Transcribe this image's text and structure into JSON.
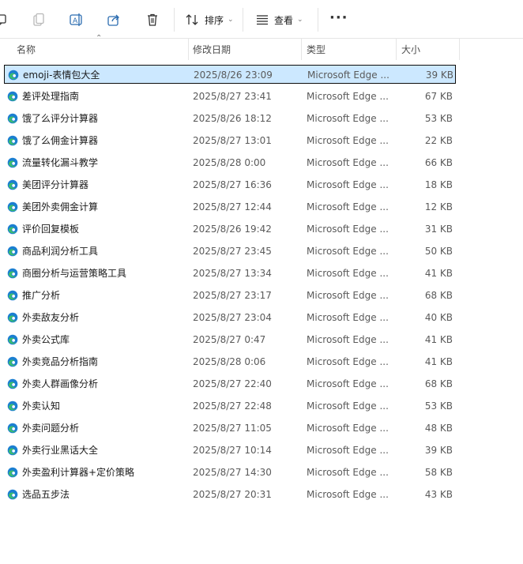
{
  "toolbar": {
    "sort_label": "排序",
    "view_label": "查看",
    "more_label": "···",
    "icons": [
      "share-icon-partial",
      "copy-icon",
      "rename-icon",
      "share-icon",
      "delete-icon",
      "sort-icon",
      "view-icon"
    ]
  },
  "columns": {
    "name": "名称",
    "date": "修改日期",
    "type": "类型",
    "size": "大小"
  },
  "files": [
    {
      "name": "emoji-表情包大全",
      "date": "2025/8/26 23:09",
      "type": "Microsoft Edge ...",
      "size": "39 KB",
      "selected": true
    },
    {
      "name": "差评处理指南",
      "date": "2025/8/27 23:41",
      "type": "Microsoft Edge ...",
      "size": "67 KB"
    },
    {
      "name": "饿了么评分计算器",
      "date": "2025/8/26 18:12",
      "type": "Microsoft Edge ...",
      "size": "53 KB"
    },
    {
      "name": "饿了么佣金计算器",
      "date": "2025/8/27 13:01",
      "type": "Microsoft Edge ...",
      "size": "22 KB"
    },
    {
      "name": "流量转化漏斗教学",
      "date": "2025/8/28 0:00",
      "type": "Microsoft Edge ...",
      "size": "66 KB"
    },
    {
      "name": "美团评分计算器",
      "date": "2025/8/27 16:36",
      "type": "Microsoft Edge ...",
      "size": "18 KB"
    },
    {
      "name": "美团外卖佣金计算",
      "date": "2025/8/27 12:44",
      "type": "Microsoft Edge ...",
      "size": "12 KB"
    },
    {
      "name": "评价回复模板",
      "date": "2025/8/26 19:42",
      "type": "Microsoft Edge ...",
      "size": "31 KB"
    },
    {
      "name": "商品利润分析工具",
      "date": "2025/8/27 23:45",
      "type": "Microsoft Edge ...",
      "size": "50 KB"
    },
    {
      "name": "商圈分析与运营策略工具",
      "date": "2025/8/27 13:34",
      "type": "Microsoft Edge ...",
      "size": "41 KB"
    },
    {
      "name": "推广分析",
      "date": "2025/8/27 23:17",
      "type": "Microsoft Edge ...",
      "size": "68 KB"
    },
    {
      "name": "外卖敌友分析",
      "date": "2025/8/27 23:04",
      "type": "Microsoft Edge ...",
      "size": "40 KB"
    },
    {
      "name": "外卖公式库",
      "date": "2025/8/27 0:47",
      "type": "Microsoft Edge ...",
      "size": "41 KB"
    },
    {
      "name": "外卖竞品分析指南",
      "date": "2025/8/28 0:06",
      "type": "Microsoft Edge ...",
      "size": "41 KB"
    },
    {
      "name": "外卖人群画像分析",
      "date": "2025/8/27 22:40",
      "type": "Microsoft Edge ...",
      "size": "68 KB"
    },
    {
      "name": "外卖认知",
      "date": "2025/8/27 22:48",
      "type": "Microsoft Edge ...",
      "size": "53 KB"
    },
    {
      "name": "外卖问题分析",
      "date": "2025/8/27 11:05",
      "type": "Microsoft Edge ...",
      "size": "48 KB"
    },
    {
      "name": "外卖行业黑话大全",
      "date": "2025/8/27 10:14",
      "type": "Microsoft Edge ...",
      "size": "39 KB"
    },
    {
      "name": "外卖盈利计算器+定价策略",
      "date": "2025/8/27 14:30",
      "type": "Microsoft Edge ...",
      "size": "58 KB"
    },
    {
      "name": "选品五步法",
      "date": "2025/8/27 20:31",
      "type": "Microsoft Edge ...",
      "size": "43 KB"
    }
  ],
  "colors": {
    "selection_bg": "#cce8ff",
    "edge_blue": "#1b7fd1",
    "edge_green": "#3cbf6a"
  }
}
